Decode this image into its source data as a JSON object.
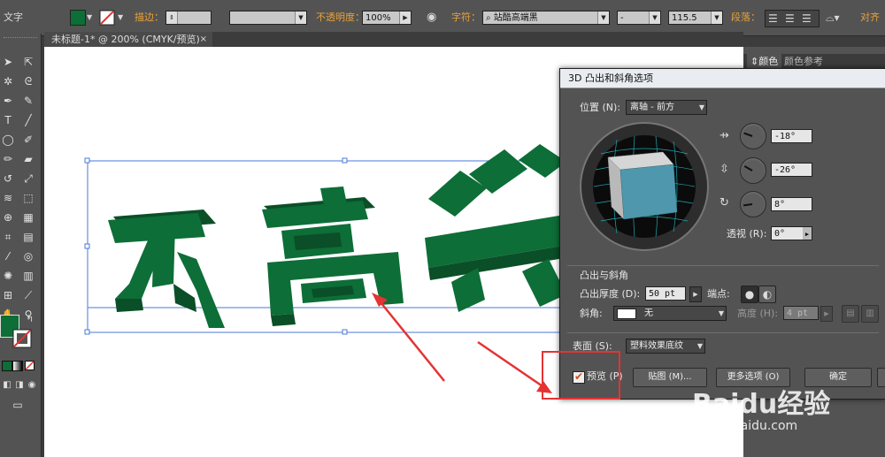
{
  "control_bar": {
    "mode_label": "文字",
    "fill_color": "#0d6e37",
    "stroke_label": "描边：",
    "opacity_label": "不透明度：",
    "opacity_value": "100%",
    "char_label": "字符：",
    "font_name": "站酷高端黑",
    "font_style": "-",
    "font_size": "115.5",
    "paragraph_label": "段落：",
    "align_label": "对齐"
  },
  "document_tab": {
    "title": "未标题-1* @ 200% (CMYK/预览)",
    "close": "×"
  },
  "right_panel": {
    "tabs": [
      "颜色",
      "颜色参考"
    ]
  },
  "canvas": {
    "text_art": "不高兴",
    "text_color": "#0d6e37"
  },
  "dialog": {
    "title": "3D 凸出和斜角选项",
    "position_label": "位置 (N):",
    "position_value": "离轴 - 前方",
    "rot_x": "-18°",
    "rot_y": "-26°",
    "rot_z": "8°",
    "perspective_label": "透视 (R):",
    "perspective_value": "0°",
    "extrude_section": "凸出与斜角",
    "extrude_depth_label": "凸出厚度 (D):",
    "extrude_depth_value": "50 pt",
    "cap_label": "端点:",
    "bevel_label": "斜角:",
    "bevel_value": "无",
    "height_label": "高度 (H):",
    "height_value": "4 pt",
    "surface_label": "表面 (S):",
    "surface_value": "塑料效果底纹",
    "preview_label": "预览 (P)",
    "preview_checked": true,
    "map_button": "贴图 (M)...",
    "more_button": "更多选项 (O)",
    "ok_button": "确定"
  },
  "watermark": {
    "brand": "Baidu经验",
    "url": "jingyan.baidu.com"
  }
}
